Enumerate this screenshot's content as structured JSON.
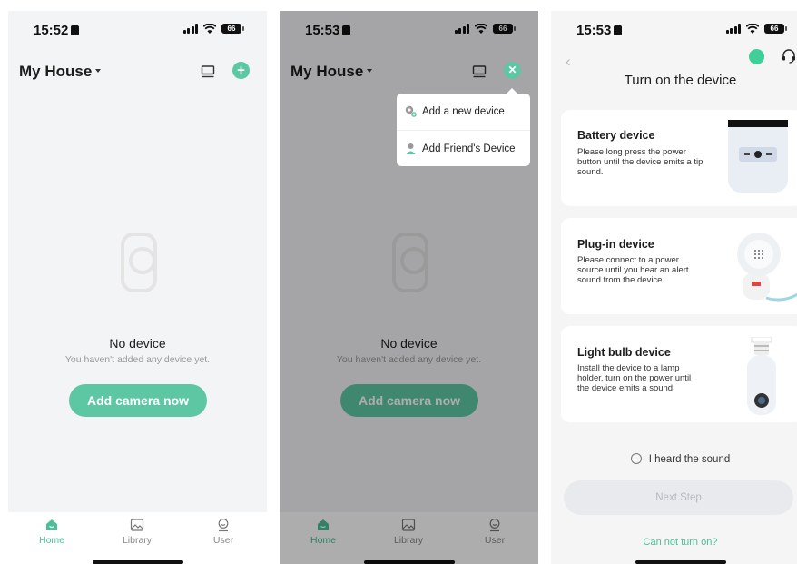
{
  "status": {
    "time1": "15:52",
    "time2": "15:53",
    "time3": "15:53",
    "battery": "66"
  },
  "home": {
    "house_name": "My House",
    "empty_title": "No device",
    "empty_subtitle": "You haven't added any device yet.",
    "add_button": "Add camera now"
  },
  "tabs": [
    {
      "label": "Home",
      "icon": "home-icon"
    },
    {
      "label": "Library",
      "icon": "image-icon"
    },
    {
      "label": "User",
      "icon": "user-icon"
    }
  ],
  "menu": {
    "items": [
      {
        "label": "Add a new device",
        "icon": "add-device-icon"
      },
      {
        "label": "Add Friend's Device",
        "icon": "friend-icon"
      }
    ]
  },
  "setup": {
    "title": "Turn on the device",
    "cards": [
      {
        "title": "Battery device",
        "desc": "Please long press the power button until the device emits a tip sound."
      },
      {
        "title": "Plug-in device",
        "desc": "Please connect to a power source until you hear an alert sound from the device"
      },
      {
        "title": "Light bulb device",
        "desc": "Install the device to a lamp holder, turn on the power until the device emits a sound."
      }
    ],
    "heard": "I heard the sound",
    "next": "Next Step",
    "cant": "Can not turn on?"
  },
  "colors": {
    "accent": "#5dc7a3",
    "background": "#f3f4f6"
  }
}
